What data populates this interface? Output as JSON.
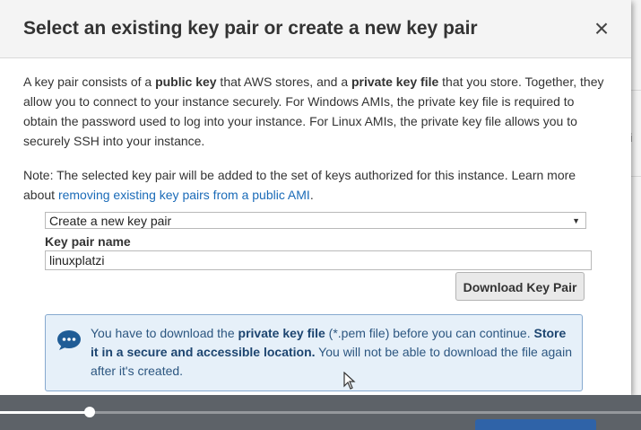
{
  "dialog": {
    "title": "Select an existing key pair or create a new key pair",
    "close_label": "×",
    "intro_segments": [
      "A key pair consists of a ",
      "public key",
      " that AWS stores, and a ",
      "private key file",
      " that you store. Together, they allow you to connect to your instance securely. For Windows AMIs, the private key file is required to obtain the password used to log into your instance. For Linux AMIs, the private key file allows you to securely SSH into your instance."
    ],
    "note_text": "Note: The selected key pair will be added to the set of keys authorized for this instance. Learn more about ",
    "note_link": "removing existing key pairs from a public AMI",
    "note_end": ".",
    "select": {
      "selected": "Create a new key pair",
      "caret": "▼"
    },
    "key_pair_label": "Key pair name",
    "key_pair_value": "linuxplatzi",
    "download_button": "Download Key Pair",
    "info": {
      "seg1": "You have to download the ",
      "seg2": "private key file",
      "seg3": " (*.pem file) before you can continue. ",
      "seg4": "Store it in a secure and accessible location.",
      "seg5": " You will not be able to download the file again after it's created.",
      "icon": "chat-bubble-icon"
    }
  },
  "background": {
    "fragment_1": "vi",
    "fragment_2": "Ir"
  },
  "video": {
    "progress": 0.14
  },
  "colors": {
    "link": "#1a6bb8",
    "info_bg": "#e6f0f9",
    "info_text": "#2c5680",
    "info_icon": "#1f5c96"
  }
}
